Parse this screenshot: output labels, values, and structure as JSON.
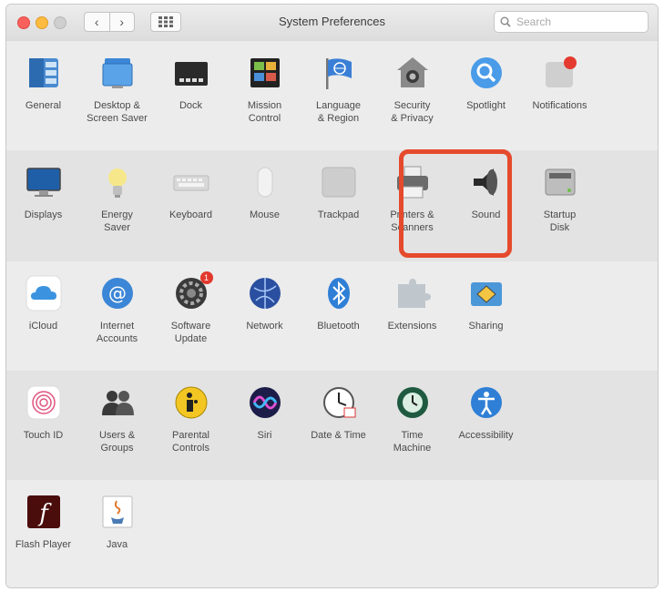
{
  "window": {
    "title": "System Preferences"
  },
  "search": {
    "placeholder": "Search"
  },
  "toolbar": {
    "back_glyph": "‹",
    "forward_glyph": "›"
  },
  "colors": {
    "highlight": "#e54a2c",
    "accent": "#3b7fd4"
  },
  "sections": [
    {
      "items": [
        {
          "label": "General",
          "icon": "general-icon"
        },
        {
          "label": "Desktop &\nScreen Saver",
          "icon": "desktop-icon"
        },
        {
          "label": "Dock",
          "icon": "dock-icon"
        },
        {
          "label": "Mission\nControl",
          "icon": "mission-control-icon"
        },
        {
          "label": "Language\n& Region",
          "icon": "flag-icon"
        },
        {
          "label": "Security\n& Privacy",
          "icon": "house-lock-icon"
        },
        {
          "label": "Spotlight",
          "icon": "magnifier-icon"
        },
        {
          "label": "Notifications",
          "icon": "notifications-icon"
        }
      ]
    },
    {
      "items": [
        {
          "label": "Displays",
          "icon": "monitor-icon"
        },
        {
          "label": "Energy\nSaver",
          "icon": "bulb-icon"
        },
        {
          "label": "Keyboard",
          "icon": "keyboard-icon"
        },
        {
          "label": "Mouse",
          "icon": "mouse-icon"
        },
        {
          "label": "Trackpad",
          "icon": "trackpad-icon"
        },
        {
          "label": "Printers &\nScanners",
          "icon": "printer-icon"
        },
        {
          "label": "Sound",
          "icon": "speaker-icon"
        },
        {
          "label": "Startup\nDisk",
          "icon": "disk-icon"
        }
      ]
    },
    {
      "items": [
        {
          "label": "iCloud",
          "icon": "cloud-icon"
        },
        {
          "label": "Internet\nAccounts",
          "icon": "at-icon"
        },
        {
          "label": "Software\nUpdate",
          "icon": "gear-icon",
          "badge": "1"
        },
        {
          "label": "Network",
          "icon": "globe-icon"
        },
        {
          "label": "Bluetooth",
          "icon": "bluetooth-icon"
        },
        {
          "label": "Extensions",
          "icon": "puzzle-icon"
        },
        {
          "label": "Sharing",
          "icon": "sharing-icon"
        }
      ]
    },
    {
      "items": [
        {
          "label": "Touch ID",
          "icon": "fingerprint-icon"
        },
        {
          "label": "Users &\nGroups",
          "icon": "users-icon"
        },
        {
          "label": "Parental\nControls",
          "icon": "parental-icon"
        },
        {
          "label": "Siri",
          "icon": "siri-icon"
        },
        {
          "label": "Date & Time",
          "icon": "clock-icon"
        },
        {
          "label": "Time\nMachine",
          "icon": "time-machine-icon"
        },
        {
          "label": "Accessibility",
          "icon": "accessibility-icon"
        }
      ]
    },
    {
      "items": [
        {
          "label": "Flash Player",
          "icon": "flash-icon"
        },
        {
          "label": "Java",
          "icon": "java-icon"
        }
      ]
    }
  ]
}
